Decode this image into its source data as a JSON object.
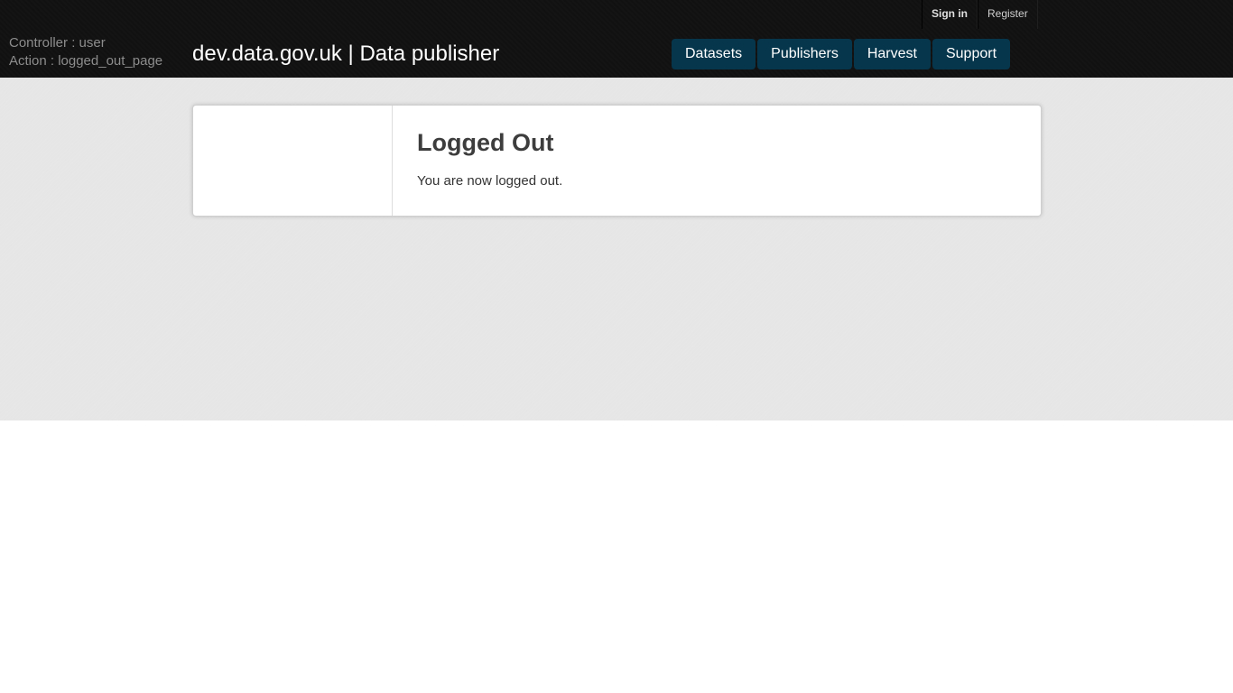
{
  "account": {
    "sign_in_label": "Sign in",
    "register_label": "Register"
  },
  "debug": {
    "controller": "Controller : user",
    "action": "Action : logged_out_page"
  },
  "site": {
    "title": "dev.data.gov.uk | Data publisher"
  },
  "nav": {
    "items": [
      {
        "label": "Datasets"
      },
      {
        "label": "Publishers"
      },
      {
        "label": "Harvest"
      },
      {
        "label": "Support"
      }
    ]
  },
  "main": {
    "heading": "Logged Out",
    "message": "You are now logged out."
  },
  "colors": {
    "header_bg": "#111111",
    "nav_button_bg": "#06364c",
    "content_bg": "#e6e6e6",
    "panel_bg": "#ffffff"
  }
}
